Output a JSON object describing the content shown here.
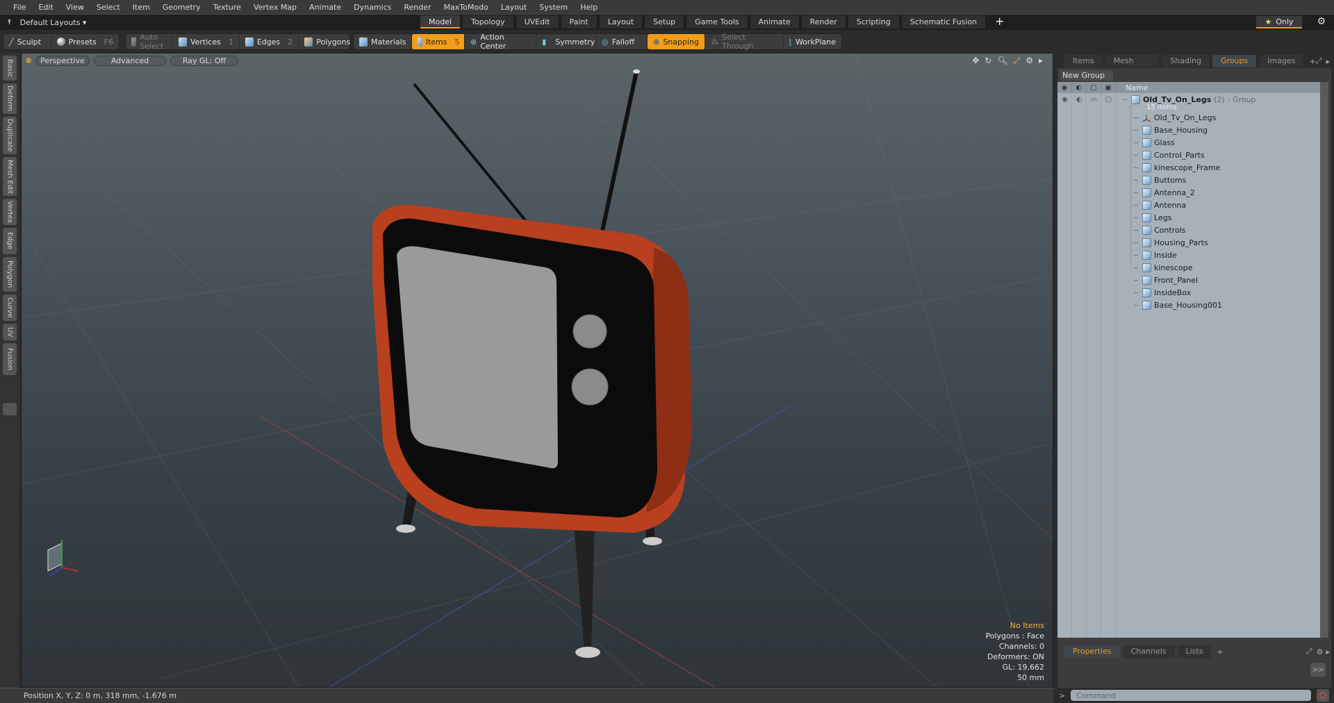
{
  "menubar": [
    "File",
    "Edit",
    "View",
    "Select",
    "Item",
    "Geometry",
    "Texture",
    "Vertex Map",
    "Animate",
    "Dynamics",
    "Render",
    "MaxToModo",
    "Layout",
    "System",
    "Help"
  ],
  "layoutbar": {
    "layout_selector": "Default Layouts ▾",
    "tabs": [
      "Model",
      "Topology",
      "UVEdit",
      "Paint",
      "Layout",
      "Setup",
      "Game Tools",
      "Animate",
      "Render",
      "Scripting",
      "Schematic Fusion"
    ],
    "active_tab": "Model",
    "add_tab": "+",
    "only_label": "Only"
  },
  "toolbar": {
    "sculpt": "Sculpt",
    "presets": "Presets",
    "presets_key": "F6",
    "auto_select": "Auto Select",
    "vertices": "Vertices",
    "vertices_key": "1",
    "edges": "Edges",
    "edges_key": "2",
    "polygons": "Polygons",
    "materials": "Materials",
    "items": "Items",
    "items_key": "5",
    "action_center": "Action Center",
    "symmetry": "Symmetry",
    "falloff": "Falloff",
    "snapping": "Snapping",
    "select_through": "Select Through",
    "workplane": "WorkPlane"
  },
  "left_tabs": [
    "Basic",
    "Deform",
    "Duplicate",
    "Mesh Edit",
    "Vertex",
    "Edge",
    "Polygon",
    "Curve",
    "UV",
    "Fusion"
  ],
  "viewport": {
    "view_mode": "Perspective",
    "shading": "Advanced",
    "raygl": "Ray GL: Off",
    "hud": {
      "selection": "No Items",
      "polygons": "Polygons : Face",
      "channels": "Channels: 0",
      "deformers": "Deformers: ON",
      "gl": "GL: 19,662",
      "scale": "50 mm"
    }
  },
  "statusbar": {
    "position": "Position X, Y, Z:   0 m, 318 mm, -1.676 m"
  },
  "right_panel": {
    "tabs": [
      "Items",
      "Mesh Ops",
      "Shading",
      "Groups",
      "Images"
    ],
    "active_tab": "Groups",
    "new_group": "New Group",
    "name_header": "Name",
    "group": {
      "name": "Old_Tv_On_Legs",
      "count": "(2)",
      "type": ": Group",
      "items_label": "15 Items"
    },
    "items": [
      "Old_Tv_On_Legs",
      "Base_Housing",
      "Glass",
      "Control_Parts",
      "kinescope_Frame",
      "Buttoms",
      "Antenna_2",
      "Antenna",
      "Legs",
      "Controls",
      "Housing_Parts",
      "Inside",
      "kinescope",
      "Front_Panel",
      "InsideBox",
      "Base_Housing001"
    ],
    "bottom_tabs": [
      "Properties",
      "Channels",
      "Lists"
    ],
    "bottom_active": "Properties",
    "expand": ">>",
    "command_placeholder": "Command"
  },
  "colors": {
    "accent": "#f39c1a",
    "tv_body": "#b8401f"
  }
}
